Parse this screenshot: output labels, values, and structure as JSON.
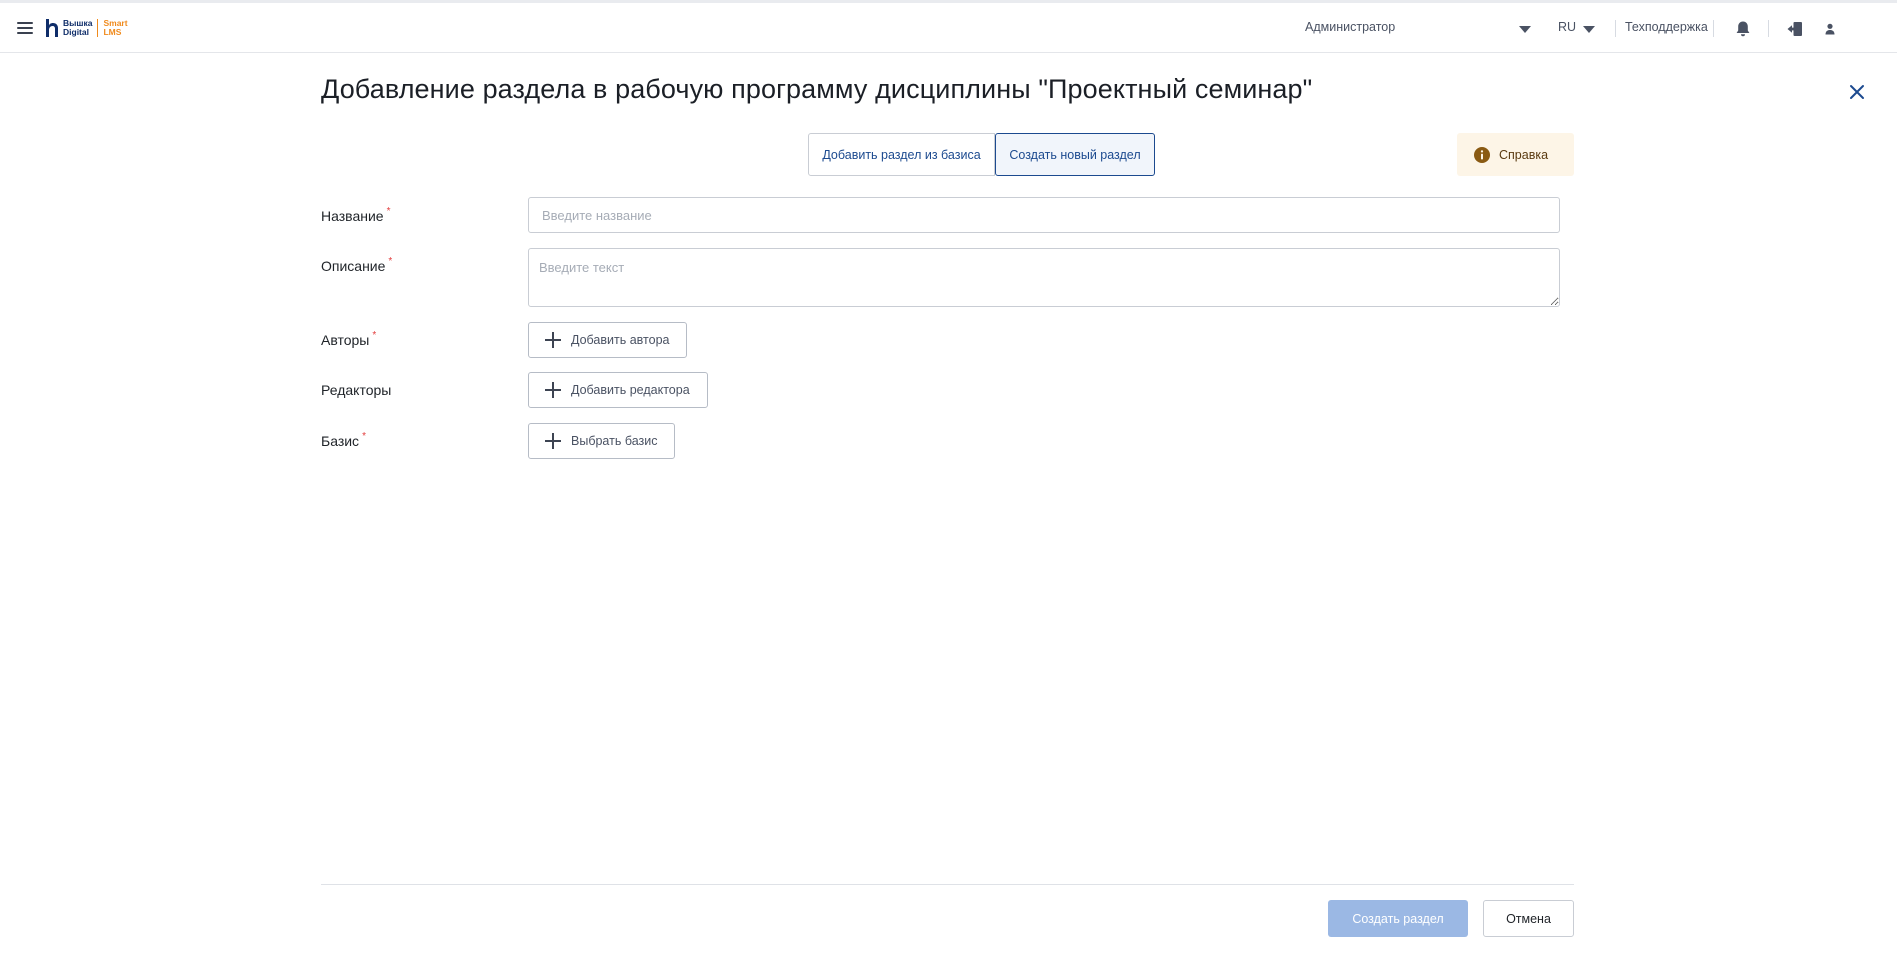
{
  "header": {
    "logo": {
      "line1": "Вышка",
      "line2": "Digital",
      "brand1": "Smart",
      "brand2": "LMS"
    },
    "role": "Администратор",
    "language": "RU",
    "support": "Техподдержка",
    "icons": [
      "menu-icon",
      "bell-icon",
      "logout-icon",
      "user-icon"
    ]
  },
  "dialog": {
    "title": "Добавление раздела в рабочую программу дисциплины \"Проектный семинар\"",
    "tabs": [
      {
        "label": "Добавить раздел из базиса",
        "active": false
      },
      {
        "label": "Создать новый раздел",
        "active": true
      }
    ],
    "help_label": "Справка",
    "fields": {
      "name": {
        "label": "Название",
        "required": "*",
        "placeholder": "Введите название",
        "value": ""
      },
      "description": {
        "label": "Описание",
        "required": "*",
        "placeholder": "Введите текст",
        "value": ""
      },
      "authors": {
        "label": "Авторы",
        "required": "*",
        "button": "Добавить автора"
      },
      "editors": {
        "label": "Редакторы",
        "button": "Добавить редактора"
      },
      "basis": {
        "label": "Базис",
        "required": "*",
        "button": "Выбрать базис"
      }
    },
    "footer": {
      "submit": "Создать раздел",
      "cancel": "Отмена"
    }
  },
  "colors": {
    "accent": "#1c4a8f",
    "submit_disabled": "#9bb8e4",
    "required": "#e23c3c",
    "help_bg": "#fdf5e7",
    "logo_blue": "#0f2d69",
    "logo_orange": "#f08a1c"
  }
}
